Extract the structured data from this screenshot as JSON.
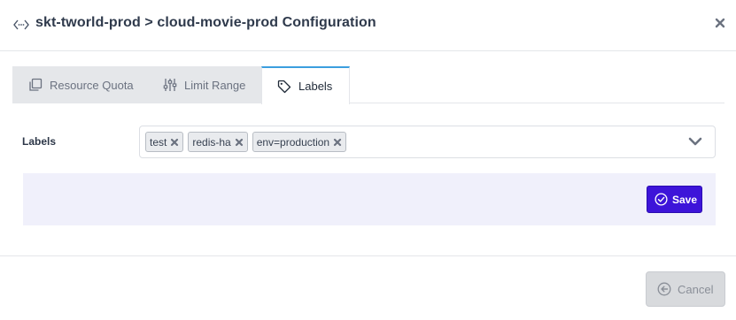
{
  "dialog": {
    "title": "skt-tworld-prod > cloud-movie-prod Configuration",
    "title_icon": "code-brackets-icon",
    "close_icon": "close-icon"
  },
  "tabs": [
    {
      "label": "Resource Quota",
      "icon": "copy-icon",
      "active": false
    },
    {
      "label": "Limit Range",
      "icon": "sliders-icon",
      "active": false
    },
    {
      "label": "Labels",
      "icon": "tag-icon",
      "active": true
    }
  ],
  "labels_field": {
    "label": "Labels",
    "values": [
      "test",
      "redis-ha",
      "env=production"
    ],
    "dropdown_icon": "chevron-down-icon"
  },
  "actions": {
    "save_label": "Save",
    "cancel_label": "Cancel"
  },
  "colors": {
    "primary": "#3d14d9",
    "tab_active_border": "#3b9ede",
    "action_bar_bg": "#f0f0fb"
  }
}
